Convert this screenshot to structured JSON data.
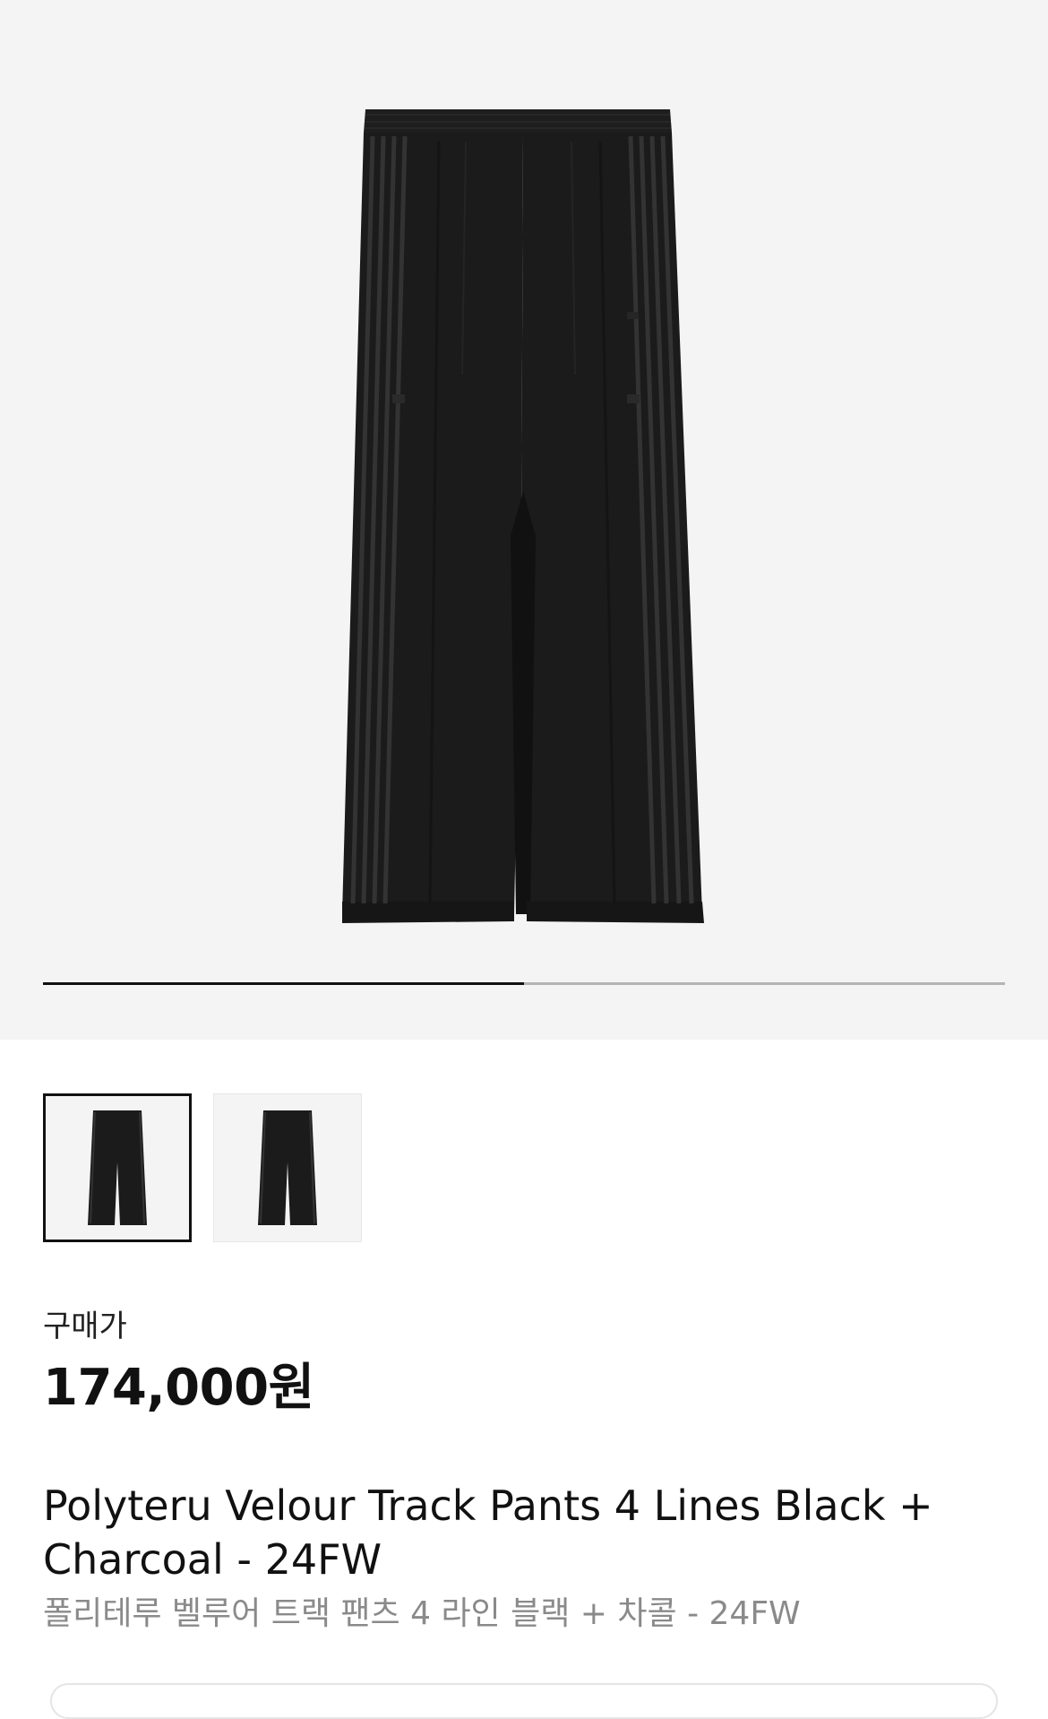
{
  "gallery": {
    "main_image": "product-photo-pants-front",
    "current_slide": 1,
    "total_slides": 2,
    "progress_fraction": 0.5,
    "thumbnails": [
      {
        "icon": "pants-thumbnail",
        "selected": true
      },
      {
        "icon": "pants-thumbnail",
        "selected": false
      }
    ]
  },
  "pricing": {
    "label": "구매가",
    "price": "174,000원"
  },
  "product": {
    "name_en": "Polyteru Velour Track Pants 4 Lines Black + Charcoal - 24FW",
    "name_ko": "폴리테루 벨루어 트랙 팬츠 4 라인 블랙 + 차콜 - 24FW"
  },
  "colors": {
    "background": "#f4f4f4",
    "garment": "#1b1b1b",
    "stripe": "#333333",
    "price_text": "#111111",
    "subtitle_text": "#8a8a8a"
  }
}
